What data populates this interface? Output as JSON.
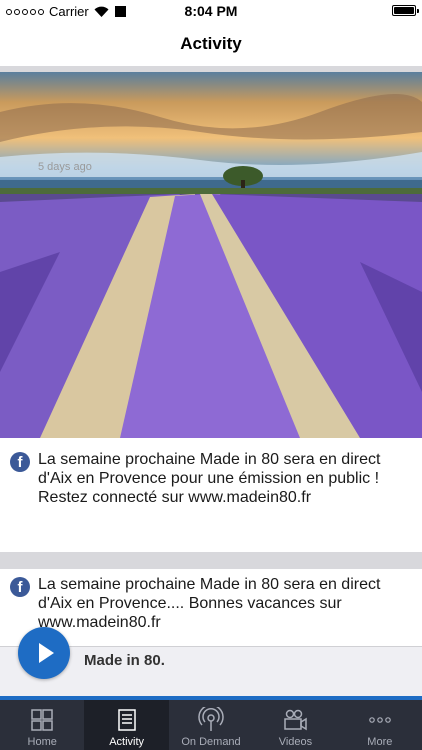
{
  "status_bar": {
    "carrier": "Carrier",
    "time": "8:04 PM"
  },
  "nav": {
    "title": "Activity"
  },
  "posts": [
    {
      "text": "La semaine prochaine Made in 80 sera en direct d'Aix en Provence pour une émission en public ! Restez connecté sur www.madein80.fr",
      "time": "5 days ago",
      "source_icon": "facebook-icon"
    },
    {
      "text": "La semaine prochaine Made in 80 sera en direct d'Aix en Provence.... Bonnes vacances sur www.madein80.fr",
      "source_icon": "facebook-icon"
    }
  ],
  "player": {
    "title": "Made in 80.",
    "state_icon": "play-icon"
  },
  "tabs": [
    {
      "label": "Home",
      "icon": "grid-icon"
    },
    {
      "label": "Activity",
      "icon": "newspaper-icon",
      "active": true
    },
    {
      "label": "On Demand",
      "icon": "podcast-icon"
    },
    {
      "label": "Videos",
      "icon": "video-icon"
    },
    {
      "label": "More",
      "icon": "more-icon"
    }
  ],
  "colors": {
    "accent": "#1e6cc4",
    "facebook": "#3b5998",
    "tabbar": "#2b2f3a"
  }
}
